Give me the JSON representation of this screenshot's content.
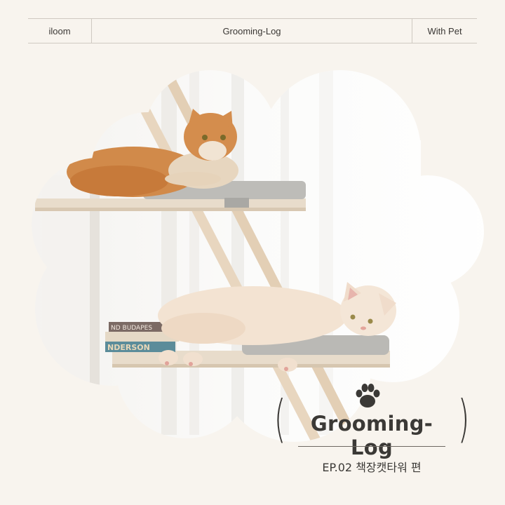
{
  "header": {
    "brand": "iloom",
    "title": "Grooming-Log",
    "section": "With Pet"
  },
  "hero": {
    "image": "photo-of-two-cats-on-bookshelf-cat-tower",
    "book_spine_1": "ND BUDAPES",
    "book_spine_2": "NDERSON"
  },
  "title_block": {
    "icon": "paw-icon",
    "open_paren": "(",
    "close_paren": ")",
    "title": "Grooming-Log",
    "episode": "EP.02 책장캣타워 편"
  },
  "colors": {
    "background": "#f8f4ee",
    "text": "#3b3936",
    "rule": "#cfc9c1"
  }
}
